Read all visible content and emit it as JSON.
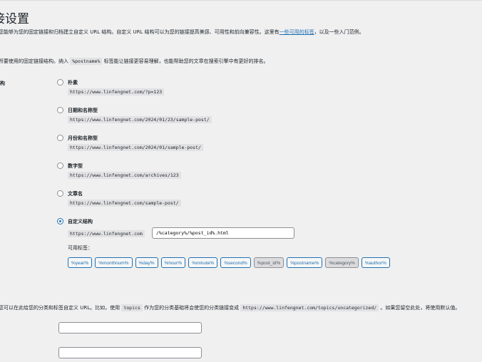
{
  "page": {
    "title": "接设置",
    "intro": "您能够为您的固定链接和归档建立自定义 URL 结构。自定义 URL 结构可以为您的链接提高美感、可用性和前向兼容性。",
    "intro_tail_before_link": "这里有",
    "intro_link": "一些可用的标签",
    "intro_tail_after_link": "，以及一些入门范例。",
    "section_text_before": "所要使用的固定链接结构。纳入",
    "section_code": "%postname%",
    "section_text_after": "标签能让链接更容易理解，也能帮助您的文章在搜索引擎中有更好的排名。",
    "row_label": "构"
  },
  "options": [
    {
      "label": "朴素",
      "code": "https://www.linfengnet.com/?p=123",
      "selected": false
    },
    {
      "label": "日期和名称型",
      "code": "https://www.linfengnet.com/2024/01/23/sample-post/",
      "selected": false
    },
    {
      "label": "月份和名称型",
      "code": "https://www.linfengnet.com/2024/01/sample-post/",
      "selected": false
    },
    {
      "label": "数字型",
      "code": "https://www.linfengnet.com/archives/123",
      "selected": false
    },
    {
      "label": "文章名",
      "code": "https://www.linfengnet.com/sample-post/",
      "selected": false
    },
    {
      "label": "自定义结构",
      "code": "https://www.linfengnet.com",
      "selected": true
    }
  ],
  "custom": {
    "value": "/%category%/%post_id%.html",
    "tags_label": "可用标签：",
    "tags": [
      {
        "text": "%year%",
        "active": false
      },
      {
        "text": "%monthnum%",
        "active": false
      },
      {
        "text": "%day%",
        "active": false
      },
      {
        "text": "%hour%",
        "active": false
      },
      {
        "text": "%minute%",
        "active": false
      },
      {
        "text": "%second%",
        "active": false
      },
      {
        "text": "%post_id%",
        "active": true
      },
      {
        "text": "%postname%",
        "active": false
      },
      {
        "text": "%category%",
        "active": true
      },
      {
        "text": "%author%",
        "active": false
      }
    ]
  },
  "optional": {
    "text_before": "您可以在此给您的分类和标签自定义 URL。比如，使用",
    "code1": "topics",
    "text_mid": "作为您的分类基础将会使您的分类链接变成",
    "code2": "https://www.linfengnet.com/topics/uncategorized/",
    "text_after": "。如果您留空此处，将使用默认值。",
    "category_base_value": "",
    "tag_base_value": ""
  }
}
